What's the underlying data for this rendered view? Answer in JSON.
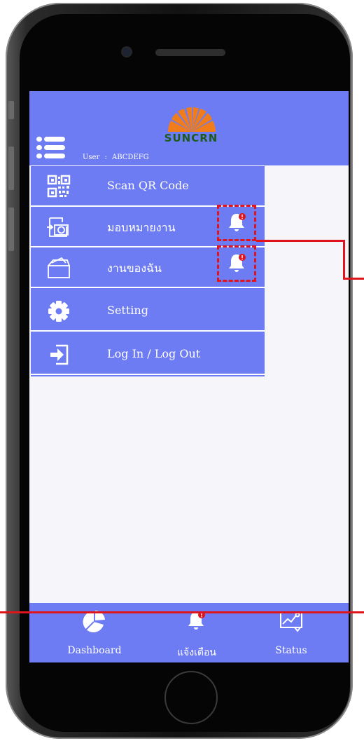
{
  "header": {
    "logo_text": "SUNCRN",
    "user_label": "User",
    "user_separator": ":",
    "user_name": "ABCDEFG"
  },
  "menu": {
    "items": [
      {
        "label": "Scan QR Code",
        "icon": "qr-code-icon"
      },
      {
        "label": "มอบหมายงาน",
        "icon": "assign-task-icon",
        "has_alert": true
      },
      {
        "label": "งานของฉัน",
        "icon": "folder-icon",
        "has_alert": true
      },
      {
        "label": "Setting",
        "icon": "gear-icon"
      },
      {
        "label": "Log In / Log Out",
        "icon": "login-icon"
      }
    ]
  },
  "bottom_nav": {
    "items": [
      {
        "label": "Dashboard",
        "icon": "pie-chart-icon"
      },
      {
        "label": "แจ้งเตือน",
        "icon": "bell-alert-icon"
      },
      {
        "label": "Status",
        "icon": "status-chart-icon"
      }
    ]
  },
  "colors": {
    "primary": "#6d7cf2",
    "alert": "#e0141c",
    "logo_orange": "#f07c1c",
    "logo_green": "#1d5b1d"
  }
}
